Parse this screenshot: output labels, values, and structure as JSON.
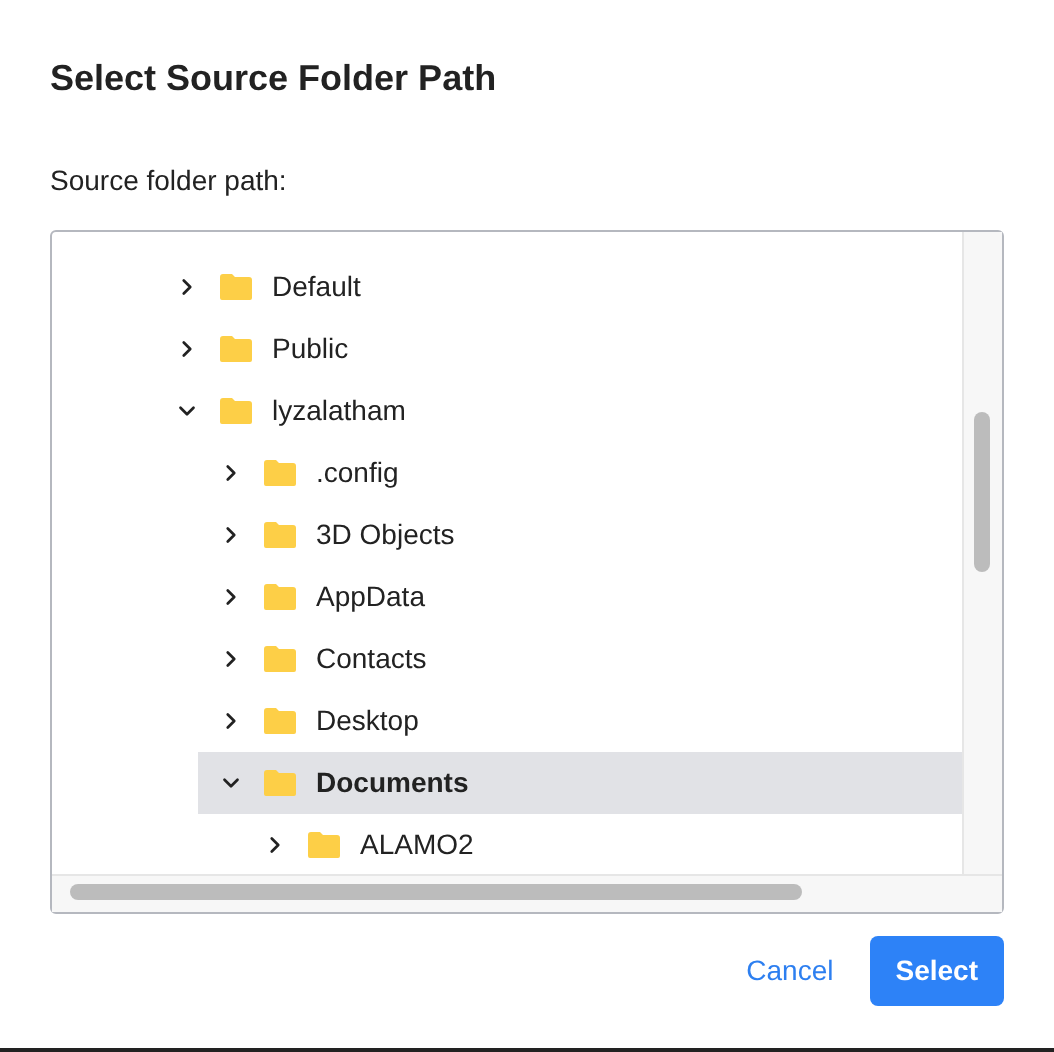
{
  "dialog": {
    "title": "Select Source Folder Path"
  },
  "field_label": "Source folder path:",
  "tree": [
    {
      "label": "Default",
      "expanded": false,
      "selected": false
    },
    {
      "label": "Public",
      "expanded": false,
      "selected": false
    },
    {
      "label": "lyzalatham",
      "expanded": true,
      "selected": false,
      "children": [
        {
          "label": ".config",
          "expanded": false,
          "selected": false
        },
        {
          "label": "3D Objects",
          "expanded": false,
          "selected": false
        },
        {
          "label": "AppData",
          "expanded": false,
          "selected": false
        },
        {
          "label": "Contacts",
          "expanded": false,
          "selected": false
        },
        {
          "label": "Desktop",
          "expanded": false,
          "selected": false
        },
        {
          "label": "Documents",
          "expanded": true,
          "selected": true,
          "children": [
            {
              "label": "ALAMO2",
              "expanded": false,
              "selected": false
            }
          ]
        }
      ]
    }
  ],
  "buttons": [
    {
      "label": "Cancel",
      "kind": "link"
    },
    {
      "label": "Select",
      "kind": "primary"
    }
  ]
}
